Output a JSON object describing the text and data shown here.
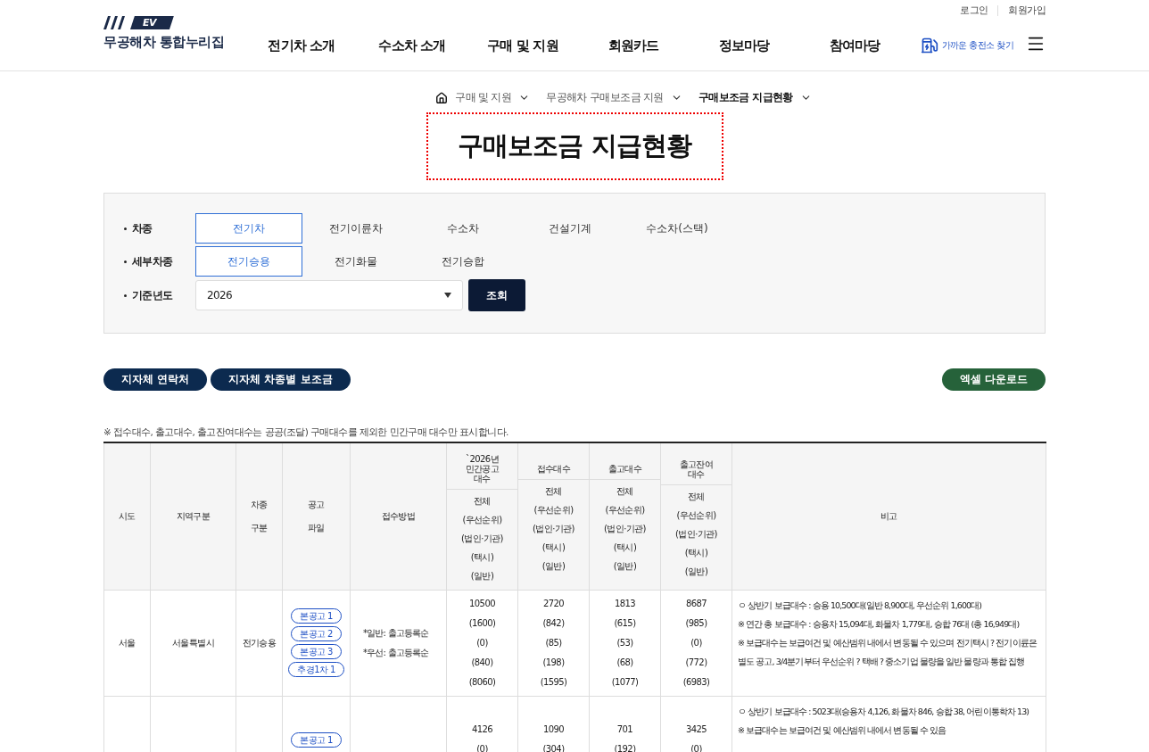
{
  "header": {
    "logo": {
      "badge": "EV",
      "name": "무공해차 통합누리집"
    },
    "util_links": [
      "로그인",
      "회원가입"
    ],
    "nav": [
      "전기차 소개",
      "수소차 소개",
      "구매 및 지원",
      "회원카드",
      "정보마당",
      "참여마당"
    ],
    "charger_link": "가까운 충전소 찾기"
  },
  "breadcrumb": [
    "구매 및 지원",
    "무공해차 구매보조금 지원",
    "구매보조금 지급현황"
  ],
  "title": "구매보조금 지급현황",
  "filters": {
    "rows": [
      {
        "label": "차종",
        "kind": "tabs",
        "options": [
          {
            "label": "전기차",
            "selected": true
          },
          {
            "label": "전기이륜차",
            "selected": false
          },
          {
            "label": "수소차",
            "selected": false
          },
          {
            "label": "건설기계",
            "selected": false
          },
          {
            "label": "수소차(스택)",
            "selected": false
          }
        ]
      },
      {
        "label": "세부차종",
        "kind": "tabs",
        "options": [
          {
            "label": "전기승용",
            "selected": true
          },
          {
            "label": "전기화물",
            "selected": false
          },
          {
            "label": "전기승합",
            "selected": false
          }
        ]
      },
      {
        "label": "기준년도",
        "kind": "select",
        "value": "2026",
        "button": "조회"
      }
    ]
  },
  "actions": {
    "left": [
      "지자체 연락처",
      "지자체 차종별 보조금"
    ],
    "right": "엑셀 다운로드"
  },
  "notice": "※ 접수대수, 출고대수, 출고잔여대수는 공공(조달) 구매대수를 제외한 민간구매 대수만 표시합니다.",
  "table": {
    "columns": [
      {
        "label": [
          "시도"
        ]
      },
      {
        "label": [
          "지역구분"
        ]
      },
      {
        "label": [
          "차종",
          "구분"
        ]
      },
      {
        "label": [
          "공고",
          "파일"
        ]
      },
      {
        "label": [
          "접수방법"
        ]
      },
      {
        "label": [
          "`2026년",
          "민간공고",
          "대수"
        ],
        "sub": [
          "전체",
          "(우선순위)",
          "(법인·기관)",
          "(택시)",
          "(일반)"
        ]
      },
      {
        "label": [
          "접수대수"
        ],
        "sub": [
          "전체",
          "(우선순위)",
          "(법인·기관)",
          "(택시)",
          "(일반)"
        ]
      },
      {
        "label": [
          "출고대수"
        ],
        "sub": [
          "전체",
          "(우선순위)",
          "(법인·기관)",
          "(택시)",
          "(일반)"
        ]
      },
      {
        "label": [
          "출고잔여",
          "대수"
        ],
        "sub": [
          "전체",
          "(우선순위)",
          "(법인·기관)",
          "(택시)",
          "(일반)"
        ]
      },
      {
        "label": [
          "비고"
        ]
      }
    ],
    "rows": [
      {
        "region": "서울",
        "district": "서울특별시",
        "type": "전기승용",
        "files": [
          "본공고 1",
          "본공고 2",
          "본공고 3",
          "추경1차 1"
        ],
        "method": [
          "*일반: 출고등록순",
          "*우선: 출고등록순"
        ],
        "counts": [
          [
            "10500",
            "(1600)",
            "(0)",
            "(840)",
            "(8060)"
          ],
          [
            "2720",
            "(842)",
            "(85)",
            "(198)",
            "(1595)"
          ],
          [
            "1813",
            "(615)",
            "(53)",
            "(68)",
            "(1077)"
          ],
          [
            "8687",
            "(985)",
            "(0)",
            "(772)",
            "(6983)"
          ]
        ],
        "remarks": [
          "ㅇ 상반기 보급대수 : 승용 10,500대(일반 8,900대, 우선순위 1,600대)",
          "※ 연간 총 보급대수 : 승용차 15,094대, 화물차 1,779대, 승합 76대 (총 16,949대)",
          "※ 보급대수는 보급여건 및 예산범위 내에서 변동될 수 있으며 전기택시 ? 전기이륜은 별도 공고, 3/4분기부터 우선순위 ? 택배 ? 중소기업 물량을 일반 물량과 통합 집행"
        ]
      },
      {
        "files": [
          "본공고 1"
        ],
        "counts": [
          [
            "4126",
            "(0)"
          ],
          [
            "1090",
            "(304)"
          ],
          [
            "701",
            "(192)"
          ],
          [
            "3425",
            "(0)"
          ]
        ],
        "remarks": [
          "ㅇ 상반기 보급대수 : 5023대(승용차 4,126, 화물차 846, 승합 38, 어린이통학차 13)",
          "※ 보급대수는 보급여건 및 예산범위 내에서 변동될 수 있음"
        ]
      }
    ]
  }
}
